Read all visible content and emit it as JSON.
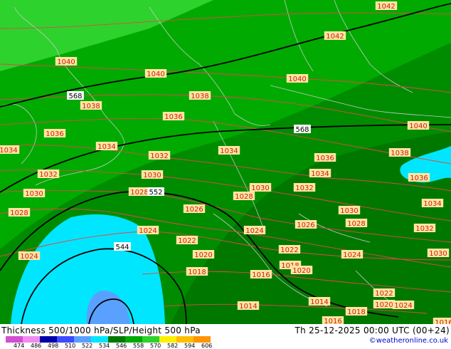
{
  "title": "Thickness 500/1000 hPa/SLP/Height 500 hPa",
  "datetime": "Th 25-12-2025 00:00 UTC (00+24)",
  "credit": "©weatheronline.co.uk",
  "colors": {
    "c1": "#d24fd2",
    "c2": "#f08cf0",
    "c3": "#0000aa",
    "c4": "#3c4bff",
    "c5": "#5aa0ff",
    "c6": "#00e6ff",
    "c7": "#007800",
    "c8": "#00aa00",
    "c9": "#2dd22d",
    "c10": "#faf000",
    "c11": "#ffbe00",
    "c12": "#ff9600"
  },
  "scale": [
    "474",
    "486",
    "498",
    "510",
    "522",
    "534",
    "546",
    "558",
    "570",
    "582",
    "594",
    "606"
  ],
  "isobars": [
    {
      "text": "1042"
    },
    {
      "text": "1042"
    },
    {
      "text": "1040"
    },
    {
      "text": "1040"
    },
    {
      "text": "1040"
    },
    {
      "text": "1038"
    },
    {
      "text": "1038"
    },
    {
      "text": "1040"
    },
    {
      "text": "1036"
    },
    {
      "text": "1036"
    },
    {
      "text": "1034"
    },
    {
      "text": "1034"
    },
    {
      "text": "1032"
    },
    {
      "text": "1034"
    },
    {
      "text": "1036"
    },
    {
      "text": "1038"
    },
    {
      "text": "1032"
    },
    {
      "text": "1030"
    },
    {
      "text": "1034"
    },
    {
      "text": "1036"
    },
    {
      "text": "1030"
    },
    {
      "text": "1028"
    },
    {
      "text": "1030"
    },
    {
      "text": "1032"
    },
    {
      "text": "1028"
    },
    {
      "text": "1028"
    },
    {
      "text": "1026"
    },
    {
      "text": "1030"
    },
    {
      "text": "1034"
    },
    {
      "text": "1024"
    },
    {
      "text": "1024"
    },
    {
      "text": "1026"
    },
    {
      "text": "1028"
    },
    {
      "text": "1032"
    },
    {
      "text": "1022"
    },
    {
      "text": "1020"
    },
    {
      "text": "1022"
    },
    {
      "text": "1024"
    },
    {
      "text": "1030"
    },
    {
      "text": "1024"
    },
    {
      "text": "1018"
    },
    {
      "text": "1016"
    },
    {
      "text": "1018"
    },
    {
      "text": "1020"
    },
    {
      "text": "1022"
    },
    {
      "text": "1014"
    },
    {
      "text": "1014"
    },
    {
      "text": "1016"
    },
    {
      "text": "1018"
    },
    {
      "text": "1020"
    },
    {
      "text": "1024"
    },
    {
      "text": "1016"
    }
  ],
  "contours": [
    {
      "text": "568"
    },
    {
      "text": "568"
    },
    {
      "text": "552"
    },
    {
      "text": "544"
    }
  ]
}
